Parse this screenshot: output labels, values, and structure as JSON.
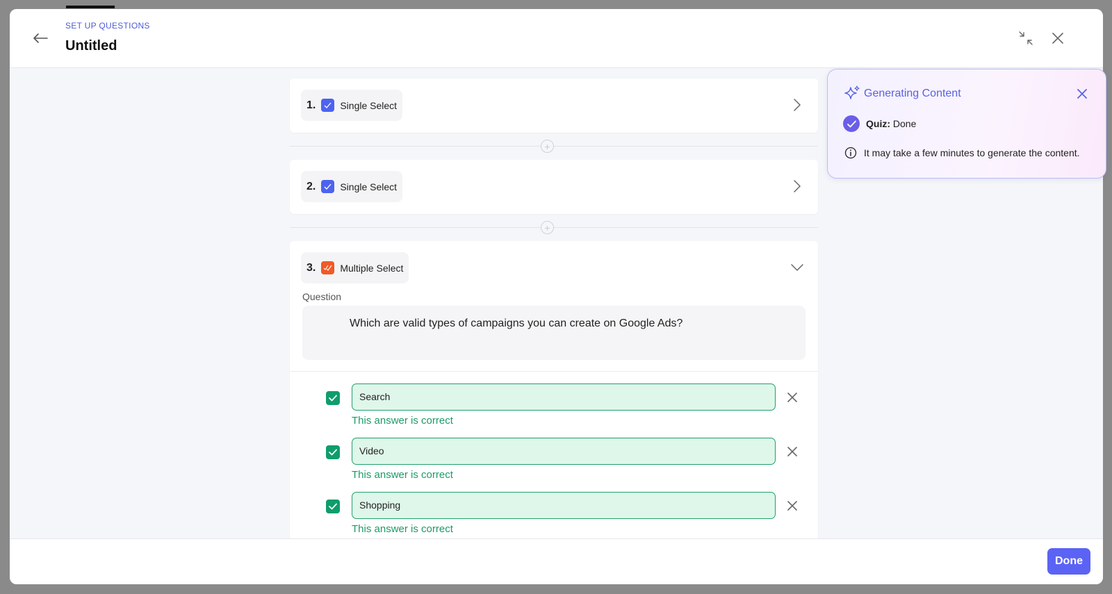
{
  "header": {
    "eyebrow": "SET UP QUESTIONS",
    "title": "Untitled"
  },
  "questions": [
    {
      "number": "1.",
      "type": "Single Select",
      "type_color": "#4d63f0",
      "expanded": false
    },
    {
      "number": "2.",
      "type": "Single Select",
      "type_color": "#4d63f0",
      "expanded": false
    },
    {
      "number": "3.",
      "type": "Multiple Select",
      "type_color": "#f05a28",
      "expanded": true,
      "question_label": "Question",
      "question_text": "Which are valid types of campaigns you can create on Google Ads?",
      "answers": [
        {
          "text": "Search",
          "checked": true,
          "note": "This answer is correct"
        },
        {
          "text": "Video",
          "checked": true,
          "note": "This answer is correct"
        },
        {
          "text": "Shopping",
          "checked": true,
          "note": "This answer is correct"
        }
      ]
    }
  ],
  "generating_panel": {
    "title": "Generating Content",
    "status_label": "Quiz:",
    "status_value": "Done",
    "info": "It may take a few minutes to generate the content."
  },
  "footer": {
    "done_label": "Done"
  },
  "colors": {
    "accent": "#5b63f5",
    "correct": "#1d9a68",
    "single_select": "#4d63f0",
    "multiple_select": "#f05a28"
  }
}
